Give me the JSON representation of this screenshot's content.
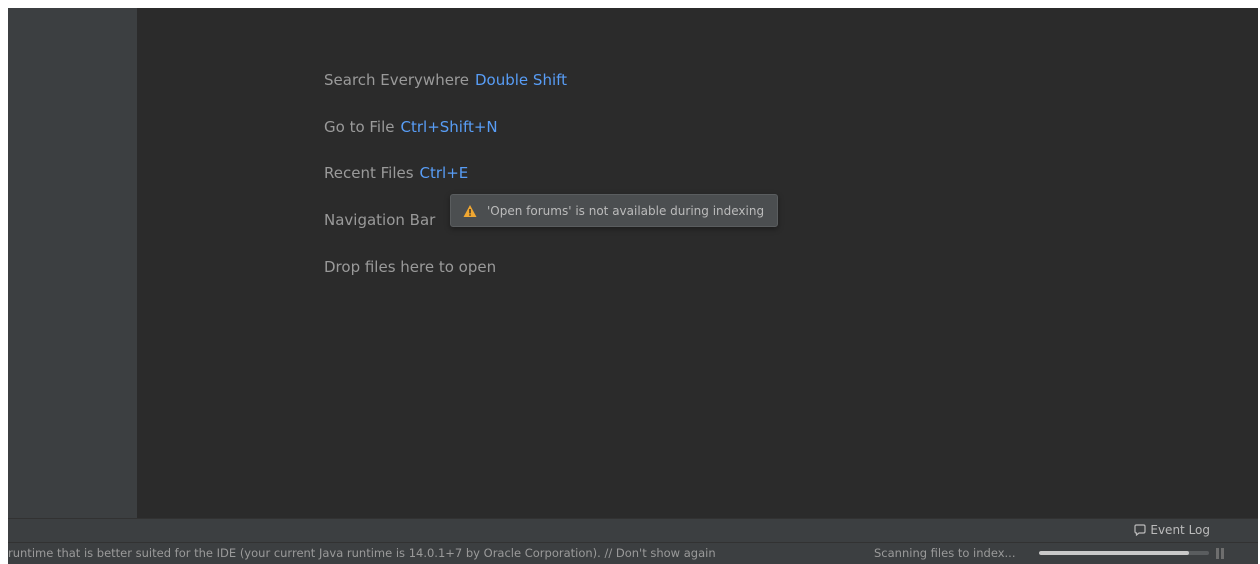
{
  "editor": {
    "hints": [
      {
        "label": "Search Everywhere",
        "shortcut": "Double Shift"
      },
      {
        "label": "Go to File",
        "shortcut": "Ctrl+Shift+N"
      },
      {
        "label": "Recent Files",
        "shortcut": "Ctrl+E"
      },
      {
        "label": "Navigation Bar",
        "shortcut": ""
      },
      {
        "label": "Drop files here to open",
        "shortcut": ""
      }
    ],
    "tooltip": {
      "icon": "warning-icon",
      "text": "'Open forums' is not available during indexing"
    }
  },
  "toolwindow_bar": {
    "event_log_label": "Event Log",
    "event_log_icon": "speech-bubble-icon"
  },
  "statusbar": {
    "message": "runtime that is better suited for the IDE (your current Java runtime is 14.0.1+7 by Oracle Corporation). // Don't show again",
    "indexing_text": "Scanning files to index...",
    "progress_fraction": 0.88
  },
  "colors": {
    "background": "#2b2b2b",
    "panel": "#3c3f41",
    "shortcut": "#589df6",
    "warning": "#f0a732"
  }
}
